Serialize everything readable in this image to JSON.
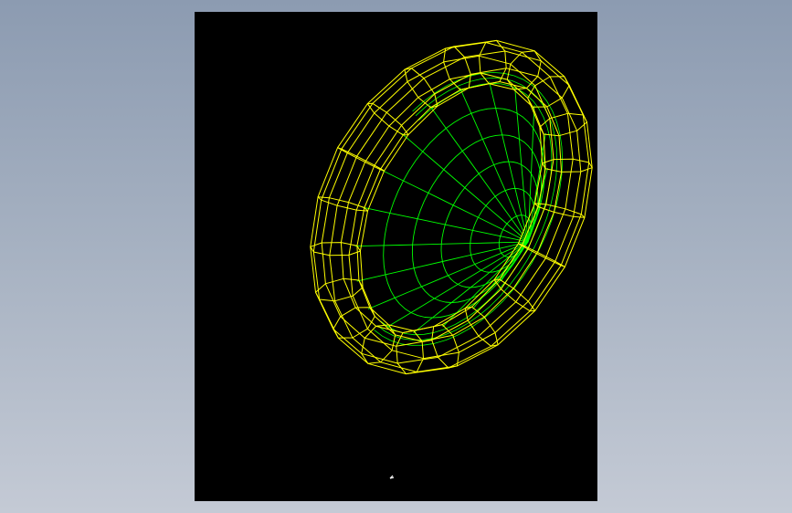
{
  "viewport": {
    "background": "#000000",
    "desktop_gradient": [
      "#8c9bb1",
      "#c4cad5"
    ]
  },
  "model": {
    "type": "wireframe",
    "shape": "torus-rim-dish",
    "rim_color": "#ffff00",
    "mesh_color": "#00ff00",
    "rim_segments": 20,
    "tube_segments": 8,
    "dish_rings": 5,
    "dish_spokes": 20
  },
  "cursor": {
    "icon": "cursor-mark-icon",
    "color": "#ffffff"
  }
}
